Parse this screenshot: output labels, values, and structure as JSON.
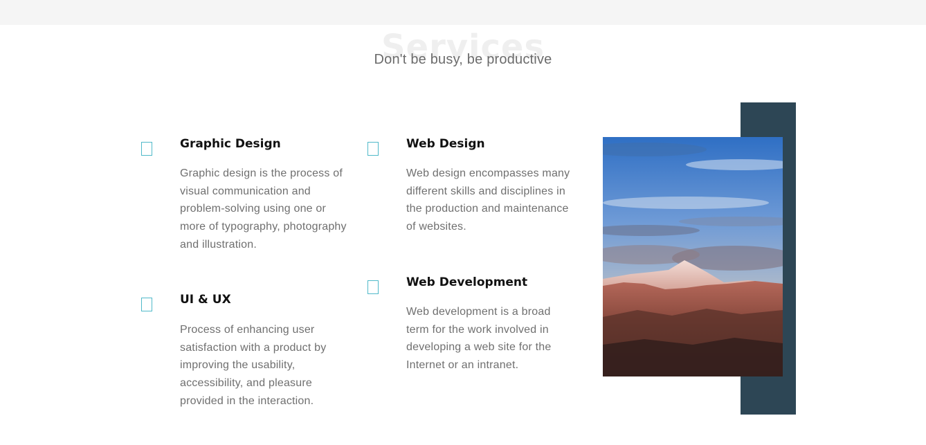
{
  "section": {
    "bg_title": "Services",
    "subtitle": "Don't be busy, be productive"
  },
  "services": [
    {
      "title": "Graphic Design",
      "text": "Graphic design is the process of visual communication and problem-solving using one or more of typography, photography and illustration."
    },
    {
      "title": "Web Design",
      "text": "Web design encompasses many different skills and disciplines in the production and maintenance of websites."
    },
    {
      "title": "UI & UX",
      "text": "Process of enhancing user satisfaction with a product by improving the usability, accessibility, and pleasure provided in the interaction."
    },
    {
      "title": "Web Development",
      "text": "Web development is a broad term for the work involved in developing a web site for the Internet or an intranet."
    }
  ],
  "colors": {
    "accent": "#4fb9c9",
    "dark_block": "#2d4655",
    "heading": "#111111",
    "body_text": "#6f6f6f"
  },
  "image": {
    "subject": "mountain-landscape"
  }
}
